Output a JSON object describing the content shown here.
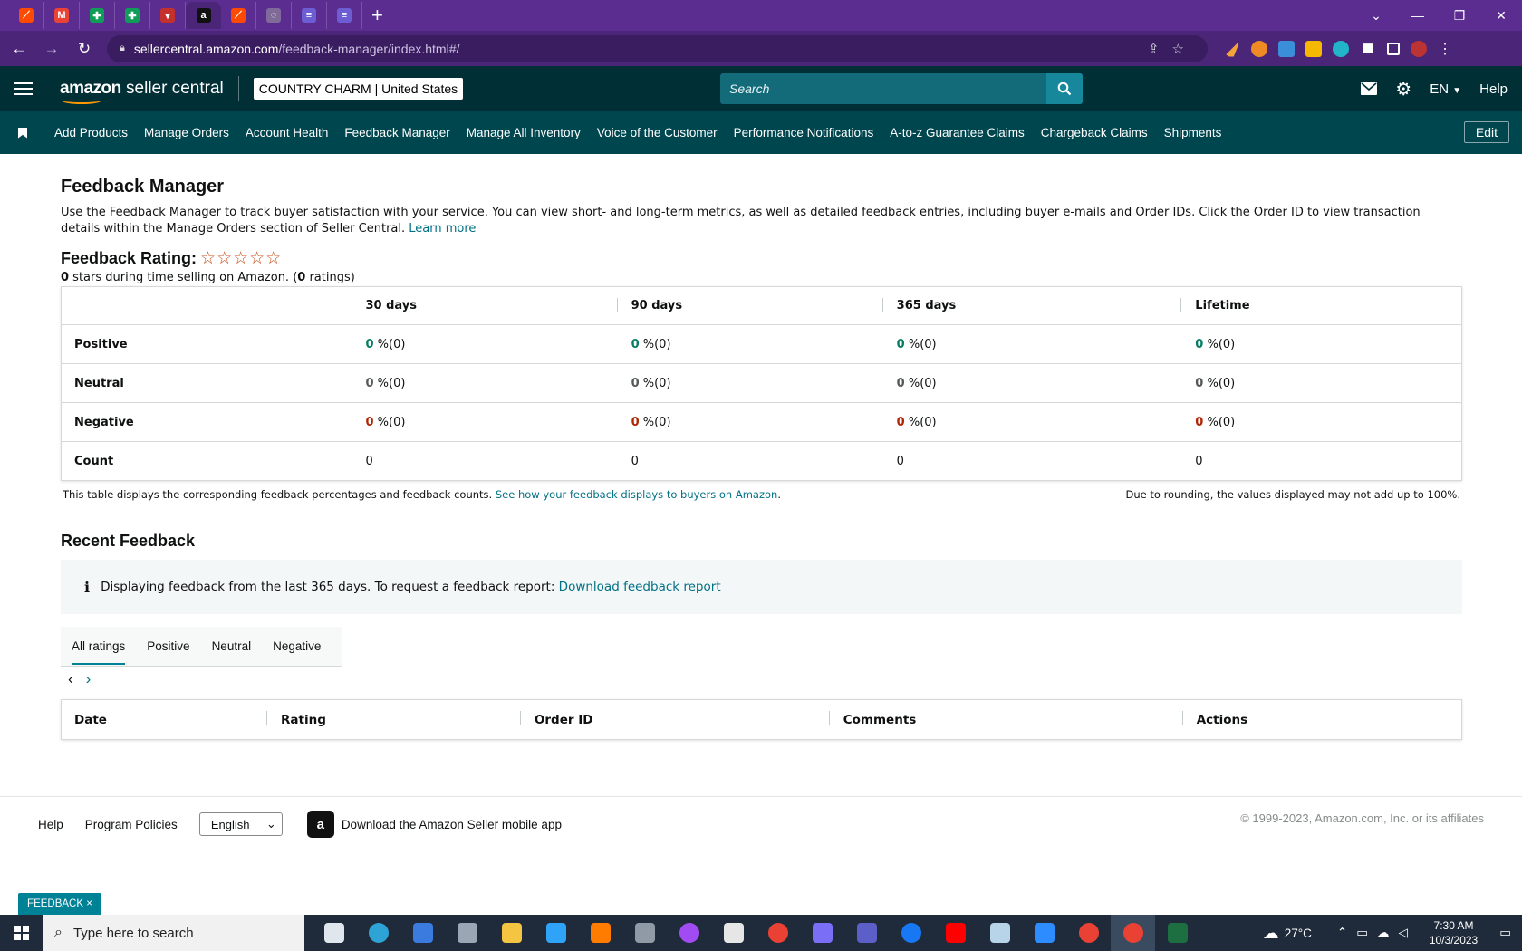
{
  "browser": {
    "tabs": [
      {
        "icon": "zapier-icon",
        "color": "#ff4a00",
        "glyph": "⟋"
      },
      {
        "icon": "gmail-icon",
        "color": "#ea4335",
        "glyph": "M"
      },
      {
        "icon": "sheets-icon",
        "color": "#0f9d58",
        "glyph": "✚"
      },
      {
        "icon": "sheets-icon",
        "color": "#0f9d58",
        "glyph": "✚"
      },
      {
        "icon": "red-app-icon",
        "color": "#c4302b",
        "glyph": "▾"
      },
      {
        "icon": "amazon-icon",
        "color": "#111111",
        "glyph": "a"
      },
      {
        "icon": "zapier-icon",
        "color": "#ff4a00",
        "glyph": "⟋"
      },
      {
        "icon": "loading-icon",
        "color": "#7f6a99",
        "glyph": "◌"
      },
      {
        "icon": "list-icon",
        "color": "#6c5dd3",
        "glyph": "≡"
      },
      {
        "icon": "list-icon",
        "color": "#6c5dd3",
        "glyph": "≡"
      }
    ],
    "url_host": "sellercentral.amazon.com",
    "url_path": "/feedback-manager/index.html#/"
  },
  "header": {
    "logo_amazon": "amazon",
    "logo_rest": " seller central",
    "account_name": "COUNTRY CHARM",
    "account_sep": " | ",
    "account_region": "United States",
    "search_placeholder": "Search",
    "language": "EN",
    "help": "Help"
  },
  "nav": {
    "items": [
      "Add Products",
      "Manage Orders",
      "Account Health",
      "Feedback Manager",
      "Manage All Inventory",
      "Voice of the Customer",
      "Performance Notifications",
      "A-to-z Guarantee Claims",
      "Chargeback Claims",
      "Shipments"
    ],
    "edit": "Edit"
  },
  "page": {
    "title": "Feedback Manager",
    "intro": "Use the Feedback Manager to track buyer satisfaction with your service. You can view short- and long-term metrics, as well as detailed feedback entries, including buyer e-mails and Order IDs. Click the Order ID to view transaction details within the Manage Orders section of Seller Central. ",
    "learn_more": "Learn more",
    "rating_label": "Feedback Rating:",
    "stars": "☆☆☆☆☆",
    "stars_value": "0",
    "stars_text_a": " stars during time selling on Amazon. (",
    "ratings_count": "0",
    "stars_text_b": " ratings)"
  },
  "metrics": {
    "columns": [
      "",
      "30 days",
      "90 days",
      "365 days",
      "Lifetime"
    ],
    "rows": [
      {
        "label": "Positive",
        "kind": "green",
        "cells": [
          {
            "pct": "0",
            "rest": " %(0)"
          },
          {
            "pct": "0",
            "rest": " %(0)"
          },
          {
            "pct": "0",
            "rest": " %(0)"
          },
          {
            "pct": "0",
            "rest": " %(0)"
          }
        ]
      },
      {
        "label": "Neutral",
        "kind": "grey",
        "cells": [
          {
            "pct": "0",
            "rest": " %(0)"
          },
          {
            "pct": "0",
            "rest": " %(0)"
          },
          {
            "pct": "0",
            "rest": " %(0)"
          },
          {
            "pct": "0",
            "rest": " %(0)"
          }
        ]
      },
      {
        "label": "Negative",
        "kind": "red",
        "cells": [
          {
            "pct": "0",
            "rest": " %(0)"
          },
          {
            "pct": "0",
            "rest": " %(0)"
          },
          {
            "pct": "0",
            "rest": " %(0)"
          },
          {
            "pct": "0",
            "rest": " %(0)"
          }
        ]
      },
      {
        "label": "Count",
        "kind": "plain",
        "cells": [
          {
            "pct": "",
            "rest": "0"
          },
          {
            "pct": "",
            "rest": "0"
          },
          {
            "pct": "",
            "rest": "0"
          },
          {
            "pct": "",
            "rest": "0"
          }
        ]
      }
    ],
    "note_left": "This table displays the corresponding feedback percentages and feedback counts. ",
    "note_link": "See how your feedback displays to buyers on Amazon",
    "note_left_end": ".",
    "note_right": "Due to rounding, the values displayed may not add up to 100%."
  },
  "recent": {
    "title": "Recent Feedback",
    "info_icon": "i",
    "alert_text": "Displaying feedback from the last 365 days. To request a feedback report: ",
    "alert_link": "Download feedback report",
    "tabs": [
      "All ratings",
      "Positive",
      "Neutral",
      "Negative"
    ],
    "active_tab": "All ratings",
    "columns": [
      "Date",
      "Rating",
      "Order ID",
      "Comments",
      "Actions"
    ]
  },
  "footer": {
    "help": "Help",
    "policies": "Program Policies",
    "language": "English",
    "app_text": "Download the Amazon Seller mobile app",
    "copyright": "© 1999-2023, Amazon.com, Inc. or its affiliates",
    "feedback_tab": "FEEDBACK ×"
  },
  "taskbar": {
    "search_placeholder": "Type here to search",
    "apps": [
      {
        "icon": "task-view-icon",
        "color": "#dfe6ee"
      },
      {
        "icon": "edge-icon",
        "color": "#2ea3d6"
      },
      {
        "icon": "store-icon",
        "color": "#3b7be0"
      },
      {
        "icon": "camera-icon",
        "color": "#9aa6b4"
      },
      {
        "icon": "file-explorer-icon",
        "color": "#f4c542"
      },
      {
        "icon": "photoshop-icon",
        "color": "#2fa3f7"
      },
      {
        "icon": "illustrator-icon",
        "color": "#ff7c00"
      },
      {
        "icon": "calculator-icon",
        "color": "#8f9aa6"
      },
      {
        "icon": "messenger-icon",
        "color": "#a14cf2"
      },
      {
        "icon": "brush-icon",
        "color": "#e6e6e6"
      },
      {
        "icon": "chrome-icon",
        "color": "#e94235"
      },
      {
        "icon": "app-icon",
        "color": "#7b6ef6"
      },
      {
        "icon": "teams-icon",
        "color": "#5b5fc7"
      },
      {
        "icon": "facebook-icon",
        "color": "#1877f2"
      },
      {
        "icon": "youtube-icon",
        "color": "#ff0000"
      },
      {
        "icon": "notepad-icon",
        "color": "#b8d4e8"
      },
      {
        "icon": "zoom-icon",
        "color": "#2d8cff"
      },
      {
        "icon": "chrome-icon",
        "color": "#e94235"
      },
      {
        "icon": "chrome-icon",
        "color": "#e94235"
      },
      {
        "icon": "excel-icon",
        "color": "#1d6f42"
      }
    ],
    "weather": "27°C",
    "time": "7:30 AM",
    "date": "10/3/2023"
  }
}
